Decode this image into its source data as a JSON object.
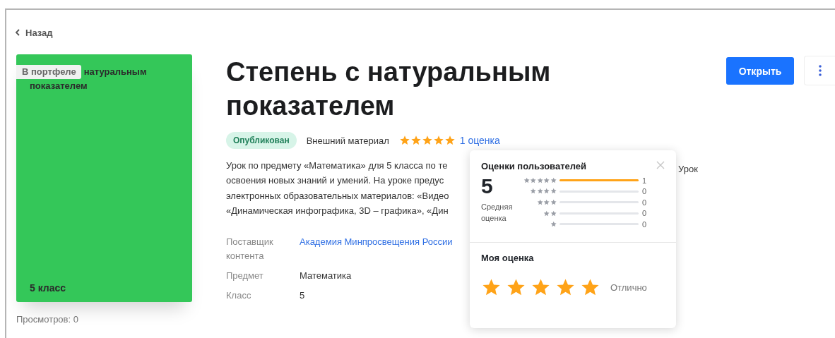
{
  "back": {
    "label": "Назад"
  },
  "card": {
    "badge": "В портфеле",
    "title_lines": [
      "натуральным",
      "показателем"
    ],
    "grade": "5 класс"
  },
  "views": "Просмотров: 0",
  "title": "Степень с натуральным показателем",
  "actions": {
    "open": "Открыть"
  },
  "status": "Опубликован",
  "source": "Внешний материал",
  "rating": {
    "stars": 5,
    "link": "1 оценка"
  },
  "description": {
    "lines": [
      "Урок по предмету «Математика» для 5 класса по те",
      "освоения новых знаний и умений. На уроке предус",
      "электронных образовательных материалов: «Видео",
      "«Динамическая инфографика, 3D – графика», «Дин"
    ],
    "tail": "Урок"
  },
  "meta": [
    {
      "label": "Поставщик контента",
      "value": "Академия Минпросвещения России",
      "kind": "link"
    },
    {
      "label": "Предмет",
      "value": "Математика",
      "kind": "text"
    },
    {
      "label": "Класс",
      "value": "5",
      "kind": "text"
    }
  ],
  "popup": {
    "title": "Оценки пользователей",
    "average": "5",
    "average_label": "Средняя оценка",
    "distribution": [
      {
        "level": 1,
        "count": "1"
      },
      {
        "level": 0,
        "count": "0"
      },
      {
        "level": 0,
        "count": "0"
      },
      {
        "level": 0,
        "count": "0"
      },
      {
        "level": 0,
        "count": "0"
      }
    ],
    "my_title": "Моя оценка",
    "my_rating": {
      "stars": 5,
      "label": "Отлично"
    }
  }
}
